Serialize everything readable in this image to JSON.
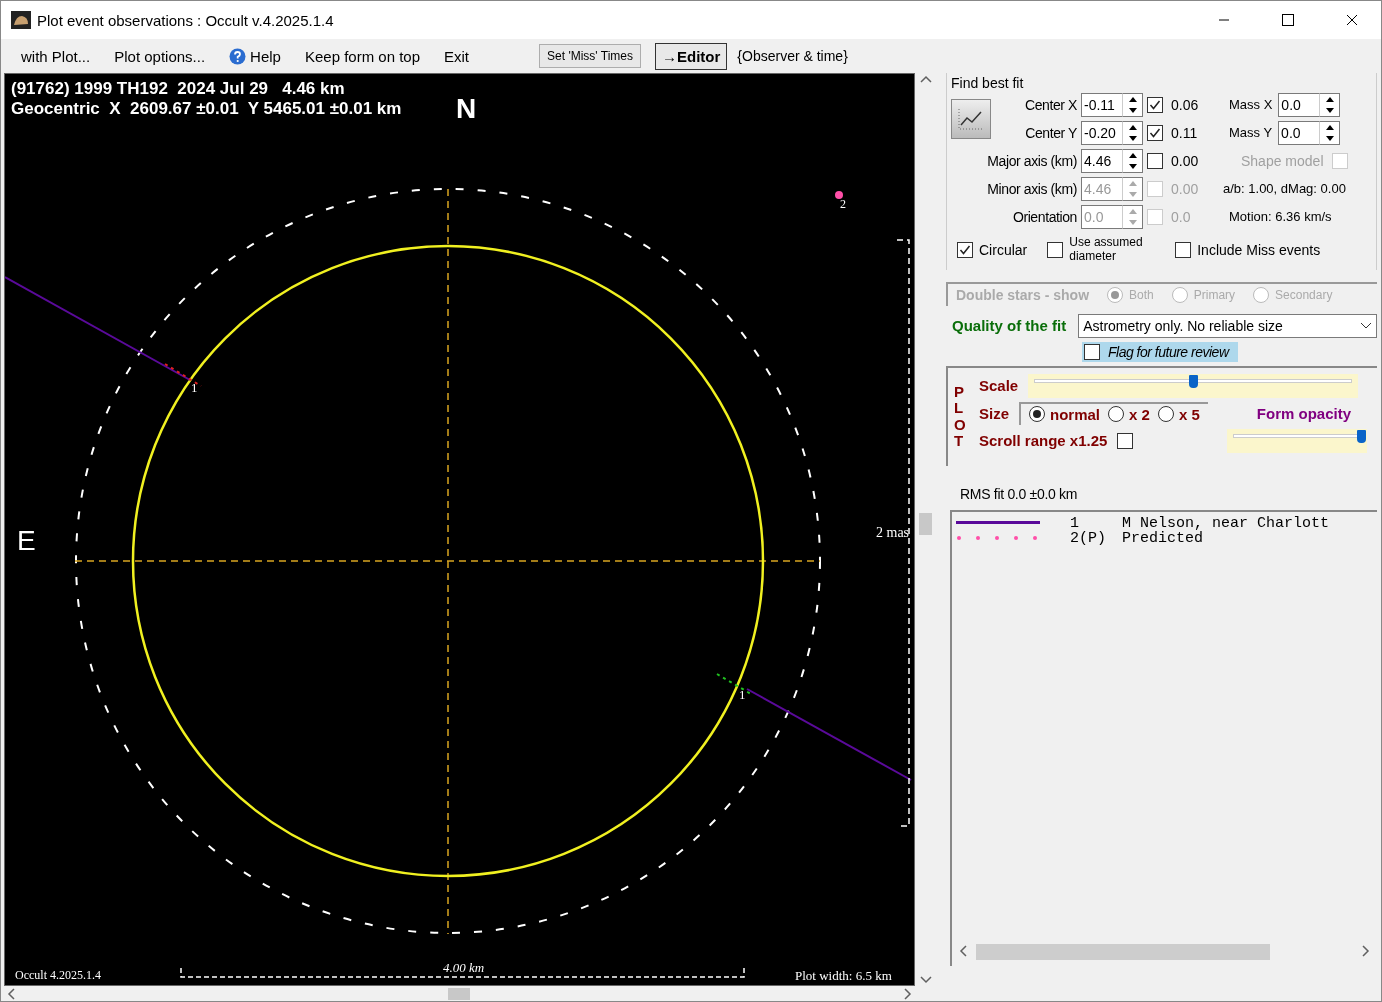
{
  "window": {
    "title": "Plot event observations : Occult v.4.2025.1.4"
  },
  "menu": [
    {
      "label": "with Plot...",
      "icon": false
    },
    {
      "label": "Plot options...",
      "icon": false
    },
    {
      "label": "Help",
      "icon": true
    },
    {
      "label": "Keep form on top",
      "icon": false
    },
    {
      "label": "Exit",
      "icon": false
    }
  ],
  "toolbar": {
    "miss_button": "Set 'Miss' Times",
    "editor_button": "→Editor",
    "observer_label": "{Observer & time}"
  },
  "plot": {
    "header": [
      "(91762) 1999 TH192  2024 Jul 29   4.46 km",
      "Geocentric  X  2609.67 ±0.01  Y 5465.01 ±0.01 km"
    ],
    "north": "N",
    "east": "E",
    "scale_label": "2 mas",
    "footer_left": "Occult 4.2025.1.4",
    "scale_bar": "4.00 km",
    "plot_width": "Plot width: 6.5 km",
    "chords": [
      {
        "labels": [
          "1",
          "1"
        ],
        "color": "#5a0a9a"
      }
    ],
    "marker": {
      "label": "2",
      "color": "#ff4fa8"
    }
  },
  "fit": {
    "title": "Find best fit",
    "params": [
      {
        "label": "Center X",
        "value": "-0.11",
        "disabled": false,
        "checked": true,
        "fit_value": "0.06"
      },
      {
        "label": "Center Y",
        "value": "-0.20",
        "disabled": false,
        "checked": true,
        "fit_value": "0.11"
      },
      {
        "label": "Major axis (km)",
        "value": "4.46",
        "disabled": false,
        "checked": false,
        "fit_value": "0.00"
      },
      {
        "label": "Minor axis (km)",
        "value": "4.46",
        "disabled": true,
        "checked": false,
        "fit_value": "0.00"
      },
      {
        "label": "Orientation",
        "value": "0.0",
        "disabled": true,
        "checked": false,
        "fit_value": "0.0"
      }
    ],
    "mass": [
      {
        "label": "Mass X",
        "value": "0.0"
      },
      {
        "label": "Mass Y",
        "value": "0.0"
      }
    ],
    "shape_model": {
      "label": "Shape model",
      "checked": false,
      "disabled": true
    },
    "ratio": "a/b: 1.00, dMag: 0.00",
    "motion": "Motion: 6.36 km/s",
    "options": [
      {
        "label": "Circular",
        "checked": true
      },
      {
        "label": "Use assumed diameter",
        "checked": false
      },
      {
        "label": "Include Miss events",
        "checked": false
      }
    ]
  },
  "double_stars": {
    "label": "Double stars - show",
    "disabled": true,
    "options": [
      {
        "label": "Both",
        "selected": true
      },
      {
        "label": "Primary",
        "selected": false
      },
      {
        "label": "Secondary",
        "selected": false
      }
    ]
  },
  "quality": {
    "label": "Quality of the fit",
    "value": "Astrometry only. No reliable size"
  },
  "flag": {
    "label": "Flag for future review",
    "checked": false
  },
  "plot_settings": {
    "title": "PLOT",
    "scale_label": "Scale",
    "scale": {
      "level": 0.5
    },
    "size_label": "Size",
    "sizes": [
      {
        "label": "normal",
        "selected": true
      },
      {
        "label": "x 2",
        "selected": false
      },
      {
        "label": "x 5",
        "selected": false
      }
    ],
    "opacity_label": "Form opacity",
    "opacity": {
      "level": 1.0
    },
    "scroll_range": {
      "label": "Scroll range x1.25",
      "checked": false
    }
  },
  "rms": "RMS fit 0.0 ±0.0 km",
  "legend": [
    {
      "kind": "solid",
      "color": "#5a0a9a",
      "number": "1",
      "name": "M Nelson, near Charlott"
    },
    {
      "kind": "dotted",
      "color": "#ff4fa8",
      "number": "2(P)",
      "name": "Predicted"
    }
  ]
}
